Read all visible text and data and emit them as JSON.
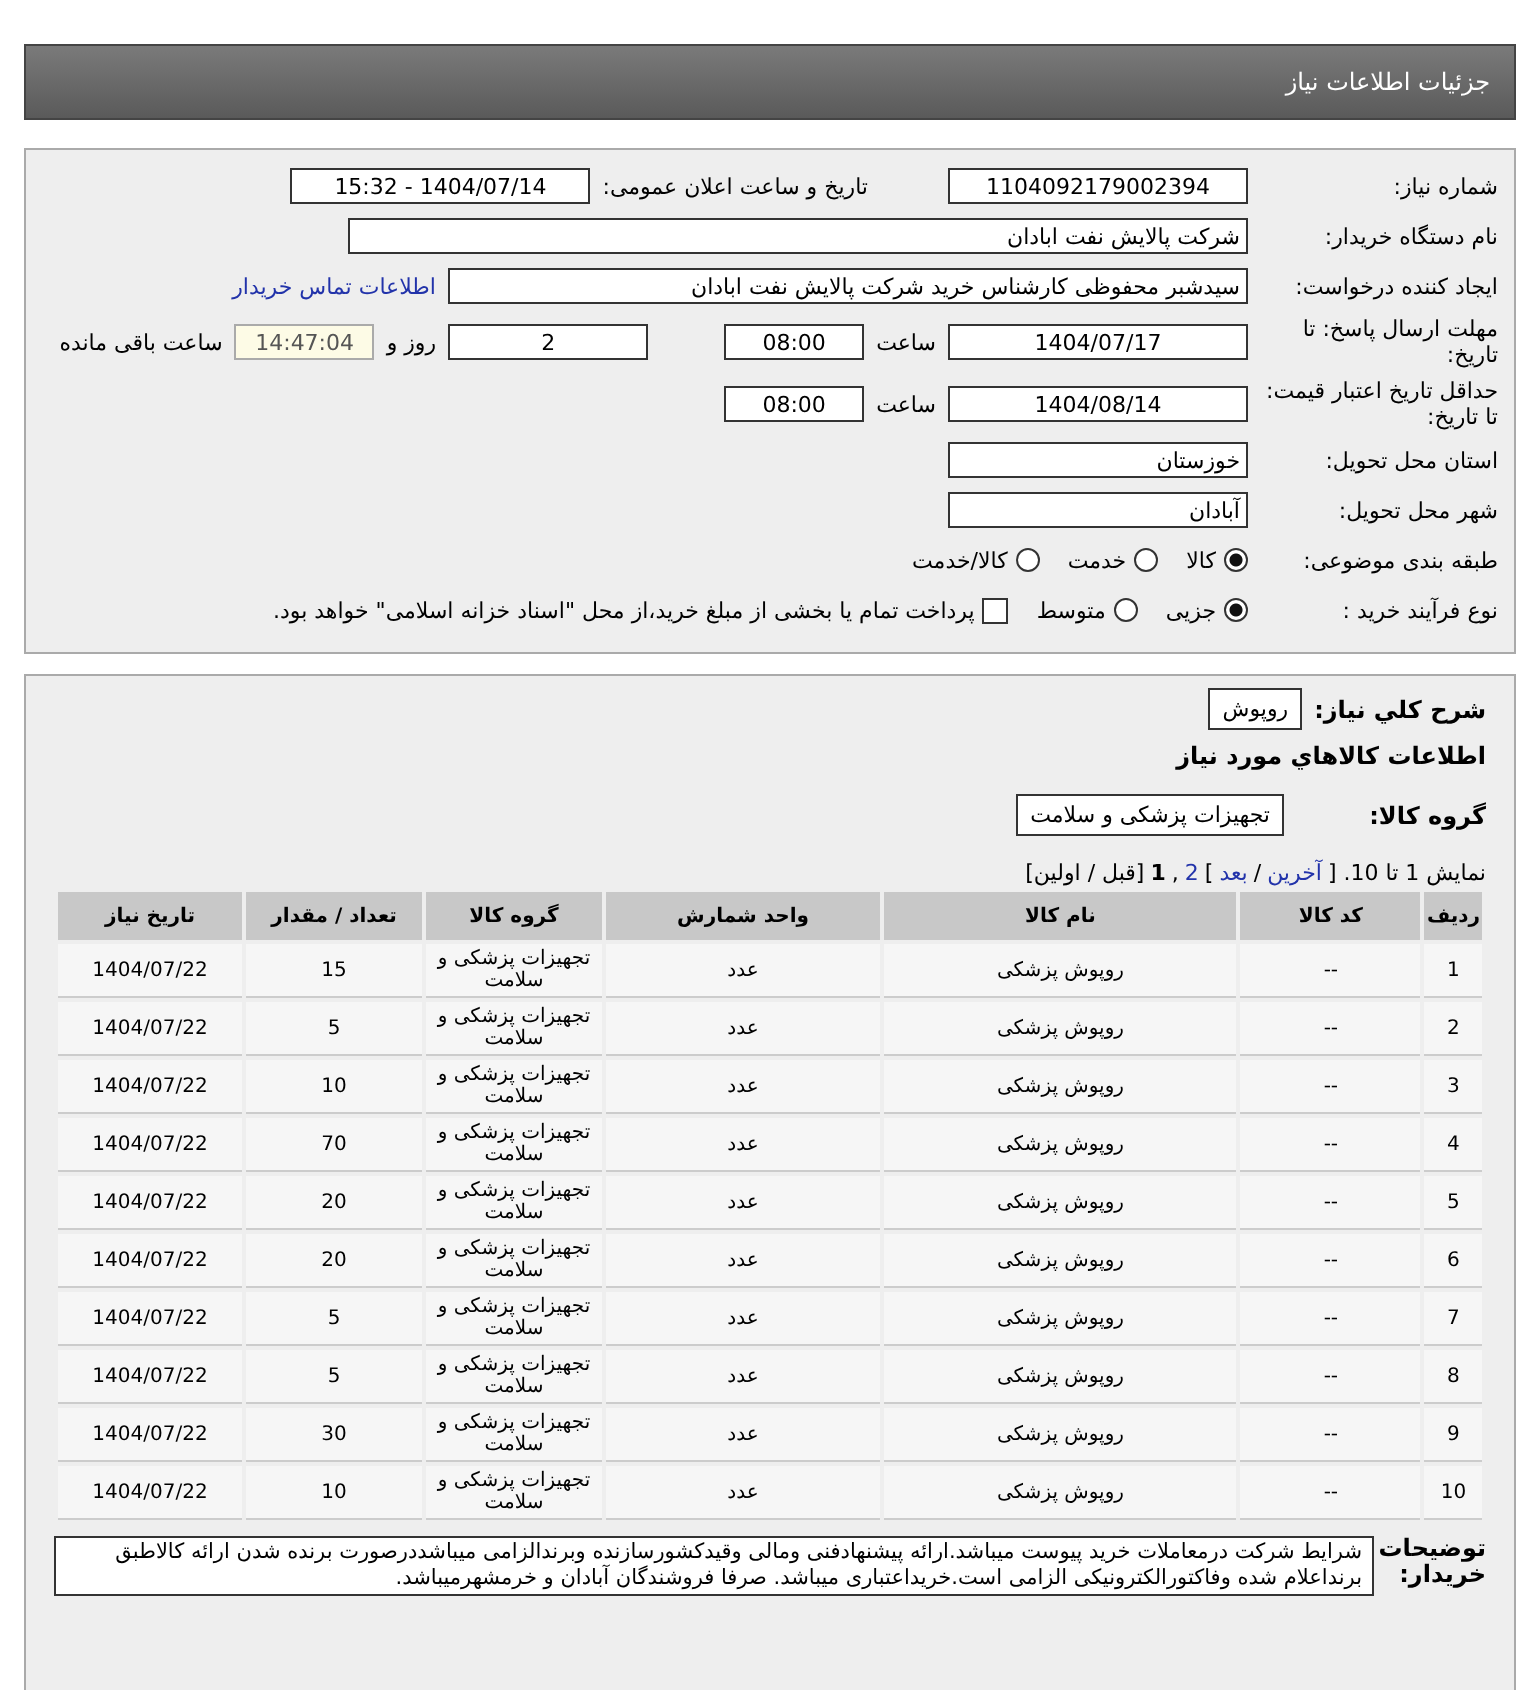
{
  "header": {
    "title": "جزئیات اطلاعات نیاز"
  },
  "need_number": {
    "label": "شماره نیاز:",
    "value": "1104092179002394"
  },
  "announce": {
    "label": "تاریخ و ساعت اعلان عمومی:",
    "value": "1404/07/14 - 15:32"
  },
  "buyer": {
    "label": "نام دستگاه خریدار:",
    "value": "شرکت پالایش نفت ابادان"
  },
  "creator": {
    "label": "ایجاد کننده درخواست:",
    "value": "سیدشبر محفوظی کارشناس خرید  شرکت پالایش نفت ابادان",
    "link": "اطلاعات تماس خریدار"
  },
  "deadline": {
    "label": "مهلت ارسال پاسخ: تا تاریخ:",
    "date": "1404/07/17",
    "time_label": "ساعت",
    "time": "08:00",
    "days": "2",
    "days_label": "روز و",
    "remaining": "14:47:04",
    "remaining_label": "ساعت باقی مانده"
  },
  "validity": {
    "label": "حداقل تاریخ اعتبار قیمت: تا تاریخ:",
    "date": "1404/08/14",
    "time_label": "ساعت",
    "time": "08:00"
  },
  "province": {
    "label": "استان محل تحویل:",
    "value": "خوزستان"
  },
  "city": {
    "label": "شهر محل تحویل:",
    "value": "آبادان"
  },
  "category": {
    "label": "طبقه بندی موضوعی:",
    "options": [
      {
        "label": "کالا",
        "selected": true
      },
      {
        "label": "خدمت",
        "selected": false
      },
      {
        "label": "کالا/خدمت",
        "selected": false
      }
    ]
  },
  "process": {
    "label": "نوع فرآیند خرید :",
    "options": [
      {
        "label": "جزیی",
        "selected": true
      },
      {
        "label": "متوسط",
        "selected": false
      }
    ],
    "payment": {
      "checked": false,
      "label": "پرداخت تمام یا بخشی از مبلغ خرید،از محل \"اسناد خزانه اسلامی\" خواهد بود."
    }
  },
  "summary": {
    "label": "شرح کلي نياز:",
    "value": "روپوش"
  },
  "items_title": "اطلاعات کالاهاي مورد نياز",
  "group": {
    "label": "گروه کالا:",
    "value": "تجهیزات پزشکی و سلامت"
  },
  "pagination": [
    {
      "kind": "text",
      "text": "نمایش 1 تا 10. ["
    },
    {
      "kind": "link",
      "text": "آخرین"
    },
    {
      "kind": "text",
      "text": "/"
    },
    {
      "kind": "link",
      "text": "بعد"
    },
    {
      "kind": "text",
      "text": "]"
    },
    {
      "kind": "link",
      "text": "2"
    },
    {
      "kind": "text",
      "text": ","
    },
    {
      "kind": "current",
      "text": "1"
    },
    {
      "kind": "text",
      "text": "[قبل / اولین]"
    }
  ],
  "table": {
    "columns": [
      "ردیف",
      "کد کالا",
      "نام کالا",
      "واحد شمارش",
      "گروه کالا",
      "تعداد / مقدار",
      "تاریخ نیاز"
    ],
    "rows": [
      [
        "1",
        "--",
        "روپوش پزشکی",
        "عدد",
        "تجهیزات پزشکی و سلامت",
        "15",
        "1404/07/22"
      ],
      [
        "2",
        "--",
        "روپوش پزشکی",
        "عدد",
        "تجهیزات پزشکی و سلامت",
        "5",
        "1404/07/22"
      ],
      [
        "3",
        "--",
        "روپوش پزشکی",
        "عدد",
        "تجهیزات پزشکی و سلامت",
        "10",
        "1404/07/22"
      ],
      [
        "4",
        "--",
        "روپوش پزشکی",
        "عدد",
        "تجهیزات پزشکی و سلامت",
        "70",
        "1404/07/22"
      ],
      [
        "5",
        "--",
        "روپوش پزشکی",
        "عدد",
        "تجهیزات پزشکی و سلامت",
        "20",
        "1404/07/22"
      ],
      [
        "6",
        "--",
        "روپوش پزشکی",
        "عدد",
        "تجهیزات پزشکی و سلامت",
        "20",
        "1404/07/22"
      ],
      [
        "7",
        "--",
        "روپوش پزشکی",
        "عدد",
        "تجهیزات پزشکی و سلامت",
        "5",
        "1404/07/22"
      ],
      [
        "8",
        "--",
        "روپوش پزشکی",
        "عدد",
        "تجهیزات پزشکی و سلامت",
        "5",
        "1404/07/22"
      ],
      [
        "9",
        "--",
        "روپوش پزشکی",
        "عدد",
        "تجهیزات پزشکی و سلامت",
        "30",
        "1404/07/22"
      ],
      [
        "10",
        "--",
        "روپوش پزشکی",
        "عدد",
        "تجهیزات پزشکی و سلامت",
        "10",
        "1404/07/22"
      ]
    ]
  },
  "notes": {
    "label": "توضیحات خریدار:",
    "text": "شرایط شرکت درمعاملات خرید پیوست میباشد.ارائه پیشنهادفنی ومالی وقیدکشورسازنده وبرندالزامی میباشددرصورت برنده شدن ارائه کالاطبق برنداعلام شده وفاکتورالکترونیکی الزامی است.خریداعتباری میباشد. صرفا فروشندگان آبادان و خرمشهرمیباشد."
  }
}
